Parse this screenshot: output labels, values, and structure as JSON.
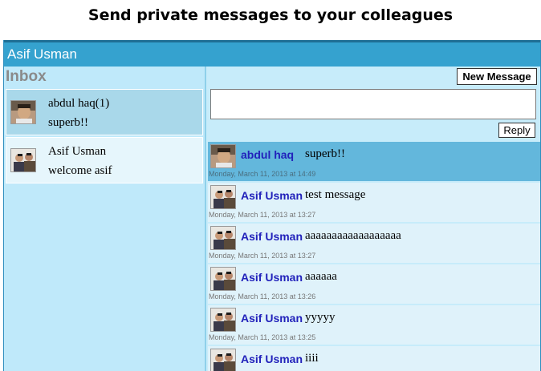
{
  "caption": "Send private messages to your colleagues",
  "header": {
    "user_name": "Asif Usman"
  },
  "sidebar": {
    "title": "Inbox",
    "conversations": [
      {
        "name": "abdul haq(1)",
        "preview": "superb!!",
        "avatar": "man-avatar-icon",
        "selected": true
      },
      {
        "name": "Asif Usman",
        "preview": "welcome asif",
        "avatar": "group-avatar-icon",
        "selected": false
      }
    ]
  },
  "main": {
    "new_message_label": "New Message",
    "reply_label": "Reply",
    "composer_value": "",
    "messages": [
      {
        "sender": "abdul haq",
        "text": "superb!!",
        "time": "Monday, March 11, 2013 at 14:49",
        "highlight": true
      },
      {
        "sender": "Asif Usman",
        "text": "test message",
        "time": "Monday, March 11, 2013 at 13:27"
      },
      {
        "sender": "Asif Usman",
        "text": "aaaaaaaaaaaaaaaaaa",
        "time": "Monday, March 11, 2013 at 13:27"
      },
      {
        "sender": "Asif Usman",
        "text": "aaaaaa",
        "time": "Monday, March 11, 2013 at 13:26"
      },
      {
        "sender": "Asif Usman",
        "text": "yyyyy",
        "time": "Monday, March 11, 2013 at 13:25"
      },
      {
        "sender": "Asif Usman",
        "text": "iiii",
        "time": ""
      }
    ]
  },
  "colors": {
    "topbar": "#35a2cf",
    "sidebar": "#bfe9fa",
    "highlight": "#63b7dc",
    "sender_name": "#2222bb"
  }
}
